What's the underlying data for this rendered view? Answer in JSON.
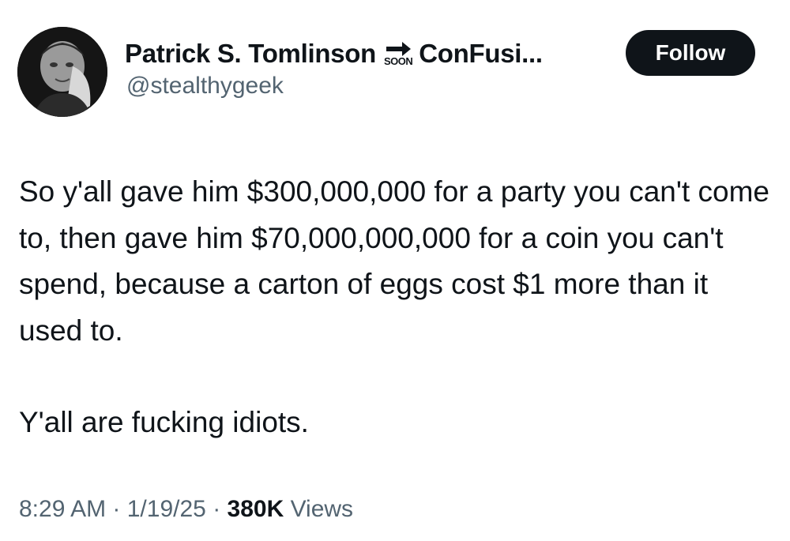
{
  "author": {
    "display_name": "Patrick S. Tomlinson",
    "badge_text": "SOON",
    "display_name_suffix": "ConFusi...",
    "handle": "@stealthygeek",
    "follow_label": "Follow"
  },
  "tweet": {
    "paragraphs": [
      "So y'all gave him $300,000,000 for a party you can't come to, then gave him $70,000,000,000 for a coin you can't spend, because a carton of eggs cost $1 more than it used to.",
      "Y'all are fucking idiots."
    ]
  },
  "meta": {
    "time": "8:29 AM",
    "separator": "·",
    "date": "1/19/25",
    "views_count": "380K",
    "views_label": "Views"
  }
}
